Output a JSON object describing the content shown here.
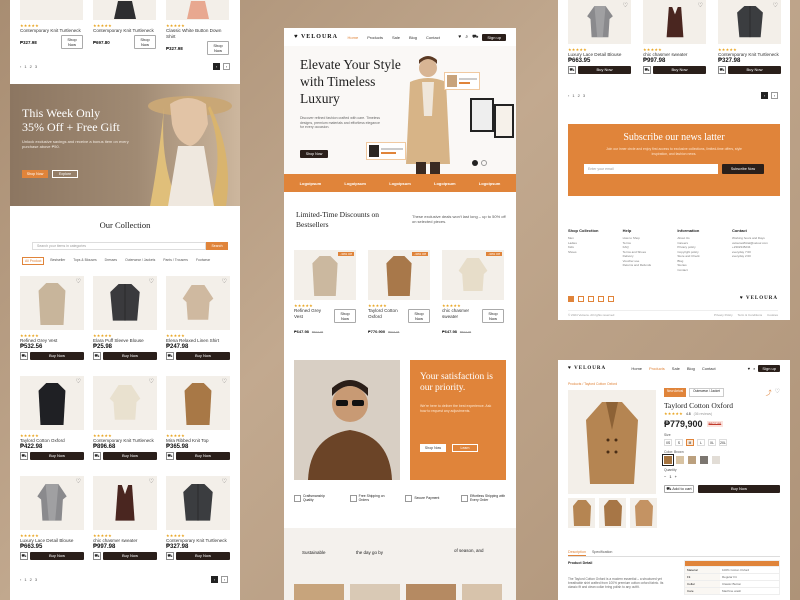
{
  "brand": "VELOURA",
  "nav": {
    "items": [
      "Home",
      "Products",
      "Sale",
      "Blog",
      "Contact"
    ],
    "signin": "Sign up",
    "active_color": "#e0843a"
  },
  "left_top": {
    "products": [
      {
        "name": "Contemporary Knit Turtleneck",
        "price": "₱327.98",
        "btn": "Shop Now"
      },
      {
        "name": "Contemporary Knit Turtleneck",
        "price": "₱697.80",
        "btn": "Shop Now"
      },
      {
        "name": "Classic White Button Down Shirt",
        "price": "₱327.98",
        "btn": "Shop Now"
      }
    ],
    "pages": [
      "1",
      "2",
      "3"
    ]
  },
  "promo": {
    "title1": "This Week Only",
    "title2": "35% Off + Free Gift",
    "text": "Unlock exclusive savings and receive a bonus item on every purchase above ₱50.",
    "btn1": "Shop Now",
    "btn2": "Explore"
  },
  "collection": {
    "title": "Our Collection",
    "search_placeholder": "Search your items in categories",
    "search_btn": "Search",
    "tabs": [
      "All Product",
      "Bestseller",
      "Tops & Blouses",
      "Dresses",
      "Outerwear / Jackets",
      "Pants / Trousers",
      "Footwear"
    ],
    "buy": "Buy Now",
    "products": [
      {
        "name": "Refined Grey Vest",
        "price": "₱532.56",
        "shape": "coat",
        "color": "#c8b59b"
      },
      {
        "name": "Elara Puff Sleeve Blouse",
        "price": "₱25.98",
        "shape": "jacket",
        "color": "#3a3a3d"
      },
      {
        "name": "Elena Relaxed Linen Shirt",
        "price": "₱247.98",
        "shape": "sweater",
        "color": "#cfb9a0"
      },
      {
        "name": "Taylord Cotton Oxford",
        "price": "₱422.98",
        "shape": "coat",
        "color": "#1f2024"
      },
      {
        "name": "Contemporary Knit Turtleneck",
        "price": "₱896.68",
        "shape": "sweater",
        "color": "#e9e1cf"
      },
      {
        "name": "Mira Ribbed Knit Top",
        "price": "₱365.98",
        "shape": "coat",
        "color": "#a87846"
      },
      {
        "name": "Luxury Lace Detail Blouse",
        "price": "₱663.95",
        "shape": "shirt",
        "color": "#8a8a8d"
      },
      {
        "name": "chic chasmer sweater",
        "price": "₱997.98",
        "shape": "vest",
        "color": "#4a2620"
      },
      {
        "name": "Contemporary Knit Turtleneck",
        "price": "₱327.98",
        "shape": "jacket",
        "color": "#3b3d40"
      }
    ],
    "pages": [
      "1",
      "2",
      "3"
    ]
  },
  "hero": {
    "title": "Elevate Your Style with Timeless Luxury",
    "text": "Discover refined fashion crafted with care. Timeless designs, premium materials and effortless elegance for every occasion.",
    "btn": "Shop Now",
    "logos": [
      "Logoipsum",
      "Logoipsum",
      "Logoipsum",
      "Logoipsum",
      "Logoipsum",
      "Logoipsum"
    ]
  },
  "discounts": {
    "title": "Limited-Time Discounts on Bestsellers",
    "text": "These exclusive deals won't last long – up to 50% off on selected pieces.",
    "badge": "-30% Off",
    "products": [
      {
        "name": "Refined Grey Vest",
        "price": "₱647.98",
        "old": "₱827.98",
        "btn": "Shop Now",
        "color": "#cbb89f",
        "shape": "coat"
      },
      {
        "name": "Taylord Cotton Oxford",
        "price": "₱770.900",
        "old": "₱827.98",
        "btn": "Shop Now",
        "color": "#a8784a",
        "shape": "coat"
      },
      {
        "name": "chic chasmer sweater",
        "price": "₱647.98",
        "old": "₱827.98",
        "btn": "Shop Now",
        "color": "#e7ddc9",
        "shape": "sweater"
      }
    ]
  },
  "satisfaction": {
    "title": "Your satisfaction is our priority.",
    "text": "We're here to deliver the best experience. Ask how to request any adjustments.",
    "btn1": "Shop Now",
    "btn2": "Learn"
  },
  "features": [
    "Craftsmanship Quality",
    "Free Shipping on Orders",
    "Secure Payment",
    "Effortless Shipping with Every Order"
  ],
  "bottom_mid": {
    "a": "Sustainable",
    "b": "the day go by",
    "c": "of season, and"
  },
  "right_top": {
    "products": [
      {
        "name": "Luxury Lace Detail Blouse",
        "price": "₱663.95",
        "btn": "Buy Now",
        "color": "#8a8a8d",
        "shape": "shirt"
      },
      {
        "name": "chic chasmer sweater",
        "price": "₱997.98",
        "btn": "Buy Now",
        "color": "#4a2620",
        "shape": "vest"
      },
      {
        "name": "Contemporary Knit Turtleneck",
        "price": "₱327.98",
        "btn": "Buy Now",
        "color": "#3b3d40",
        "shape": "jacket"
      }
    ],
    "pages": [
      "1",
      "2",
      "3"
    ]
  },
  "newsletter": {
    "title": "Subscribe our news latter",
    "text": "Join our inner circle and enjoy first access to exclusive collections, limited-time offers, style inspiration, and fashion news.",
    "placeholder": "Enter your email",
    "btn": "Subscribe Now"
  },
  "footer": {
    "cols": [
      {
        "title": "Shop Collection",
        "items": [
          "Men",
          "Ladies",
          "Kids",
          "Shoes"
        ]
      },
      {
        "title": "Help",
        "items": [
          "How to Shop",
          "Terms",
          "FAQ",
          "Terms and Shoes",
          "Delivery",
          "Voucher use",
          "Returns and Refunds"
        ]
      },
      {
        "title": "Information",
        "items": [
          "About Us",
          "Careers",
          "Privacy policy",
          "Copyright policy",
          "Store and Check",
          "Blog",
          "Stories",
          "Contact"
        ]
      },
      {
        "title": "Contact",
        "items": [
          "Working hours and Days",
          "velouraofficial@velour.com",
          "+2302345234",
          "everyday 7:00",
          "everyday 2:00"
        ]
      }
    ],
    "copyright": "© 2024 Veloura. All rights reserved",
    "links": [
      "Privacy Policy",
      "Term & Conditions",
      "Cookies"
    ]
  },
  "detail": {
    "breadcrumb": "Products / Taylord Cotton Oxford",
    "tags": [
      "New Arrival",
      "Outerwear / Jacket"
    ],
    "name": "Taylord Cotton Oxford",
    "rating": "4.8",
    "reviews": "(36 reviews)",
    "price": "₱779,900",
    "old": "₱827.98",
    "size_label": "Size",
    "sizes": [
      "XS",
      "S",
      "M",
      "L",
      "XL",
      "2XL"
    ],
    "color_label": "Color: Brown",
    "colors": [
      "#a6743f",
      "#d8c3a3",
      "#bba07e",
      "#7c7670",
      "#e2ddd6"
    ],
    "qty_label": "Quantity",
    "qty": "1",
    "cart_btn": "Add to cart",
    "buy_btn": "Buy Now",
    "tabs": [
      "Description",
      "Specification"
    ],
    "desc_title": "Product Detail",
    "desc": "The Taylord Cotton Oxford is a modern essential – a structured yet breathable shirt crafted from 100% premium cotton oxford fabric. Its classic fit and clean collar bring polish to any outfit.",
    "specs": [
      [
        "Material",
        "100% Cotton Oxford"
      ],
      [
        "Fit",
        "Regular Fit"
      ],
      [
        "Collar",
        "Classic Button"
      ],
      [
        "Care",
        "Machine wash"
      ]
    ]
  }
}
